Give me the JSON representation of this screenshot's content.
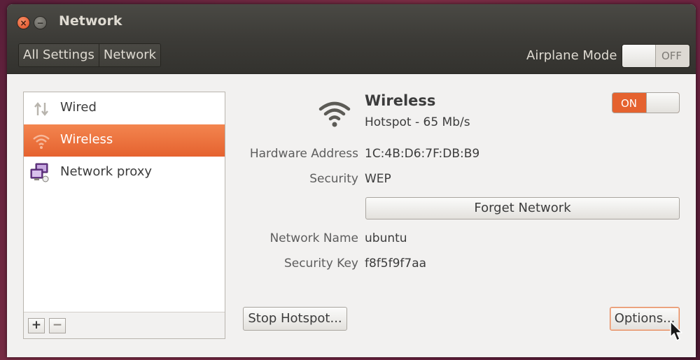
{
  "window": {
    "title": "Network",
    "close_glyph": "×",
    "minimize_glyph": "−"
  },
  "toolbar": {
    "breadcrumbs": [
      "All Settings",
      "Network"
    ],
    "airplane_label": "Airplane Mode",
    "airplane_state": "OFF"
  },
  "sidebar": {
    "items": [
      {
        "label": "Wired",
        "icon": "wired-arrows-icon",
        "selected": false
      },
      {
        "label": "Wireless",
        "icon": "wifi-icon",
        "selected": true
      },
      {
        "label": "Network proxy",
        "icon": "network-proxy-icon",
        "selected": false
      }
    ],
    "add_label": "+",
    "remove_label": "−"
  },
  "device": {
    "name": "Wireless",
    "status": "Hotspot - 65 Mb/s",
    "toggle_state": "ON",
    "icon": "wifi-icon"
  },
  "properties": {
    "hardware_address_label": "Hardware Address",
    "hardware_address": "1C:4B:D6:7F:DB:B9",
    "security_label": "Security",
    "security": "WEP",
    "network_name_label": "Network Name",
    "network_name": "ubuntu",
    "security_key_label": "Security Key",
    "security_key": "f8f5f9f7aa"
  },
  "buttons": {
    "forget": "Forget Network",
    "stop_hotspot": "Stop Hotspot...",
    "options": "Options..."
  },
  "colors": {
    "accent": "#e5622f",
    "titlebar": "#3c3b37",
    "window_bg": "#f2f1f0"
  }
}
